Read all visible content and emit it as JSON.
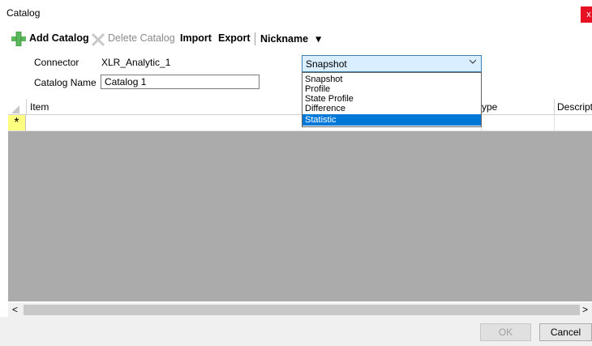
{
  "window": {
    "title": "Catalog",
    "close_glyph": "x"
  },
  "toolbar": {
    "add_catalog": "Add Catalog",
    "delete_catalog": "Delete Catalog",
    "import": "Import",
    "export": "Export",
    "nickname": "Nickname",
    "nickname_arrow": "▾"
  },
  "form": {
    "connector_label": "Connector",
    "connector_value": "XLR_Analytic_1",
    "catalog_name_label": "Catalog Name",
    "catalog_name_value": "Catalog 1"
  },
  "type_combo": {
    "selected": "Snapshot",
    "options": [
      "Snapshot",
      "Profile",
      "State Profile",
      "Difference",
      "Statistic"
    ],
    "highlighted_index": 4
  },
  "grid": {
    "columns": [
      "Item",
      "ype",
      "Descripti"
    ],
    "new_row_marker": "*"
  },
  "scrollbar": {
    "left_arrow": "<",
    "right_arrow": ">"
  },
  "buttons": {
    "ok": "OK",
    "cancel": "Cancel"
  }
}
